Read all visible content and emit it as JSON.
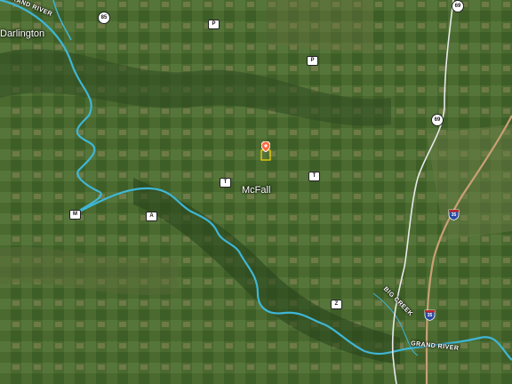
{
  "map": {
    "places": {
      "darlington": "Darlington",
      "mcfall": "McFall"
    },
    "rivers": {
      "grand_river_upper": "GRAND RIVER",
      "grand_river_lower": "GRAND RIVER",
      "big_creek": "BIG CREEK"
    },
    "routes": {
      "hwy_85": "85",
      "hwy_69_top": "69",
      "hwy_69_mid": "69",
      "route_p_1": "P",
      "route_p_2": "P",
      "route_t_1": "T",
      "route_t_2": "T",
      "route_a": "A",
      "route_m": "M",
      "route_z": "Z",
      "i35_upper": "35",
      "i35_lower": "35"
    },
    "colors": {
      "river": "#3fb6d6",
      "road_us": "#e8e8e8",
      "road_interstate": "#c8a074",
      "marker": "#ff6a3d",
      "parcel_outline": "#f0d000"
    },
    "marker_icon": "property-pin-icon"
  }
}
